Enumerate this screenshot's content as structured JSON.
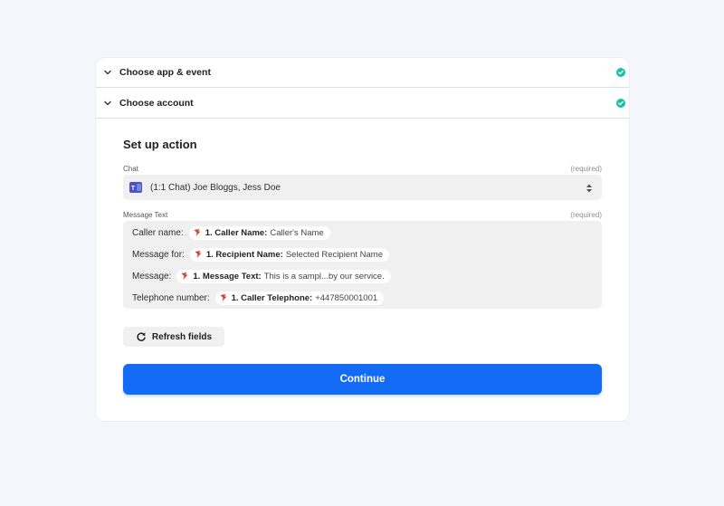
{
  "steps": [
    {
      "label": "Choose app & event",
      "status": "complete"
    },
    {
      "label": "Choose account",
      "status": "complete"
    }
  ],
  "setup": {
    "title": "Set up action",
    "chat": {
      "label": "Chat",
      "required": "(required)",
      "value": "(1:1 Chat) Joe Bloggs, Jess Doe",
      "app_icon": "microsoft-teams-icon"
    },
    "message_text": {
      "label": "Message Text",
      "required": "(required)",
      "lines": [
        {
          "prefix": "Caller name:",
          "field": "1. Caller Name:",
          "value": "Caller's Name"
        },
        {
          "prefix": "Message for:",
          "field": "1. Recipient Name:",
          "value": "Selected Recipient Name"
        },
        {
          "prefix": "Message:",
          "field": "1. Message Text:",
          "value": "This is a sampl...by our service."
        },
        {
          "prefix": "Telephone number:",
          "field": "1. Caller Telephone:",
          "value": "+447850001001"
        }
      ]
    },
    "refresh_label": "Refresh fields",
    "continue_label": "Continue"
  },
  "colors": {
    "accent": "#136bf5",
    "success": "#18c3a5",
    "background": "#f4f6fb",
    "field_bg": "#f0f0f0"
  }
}
